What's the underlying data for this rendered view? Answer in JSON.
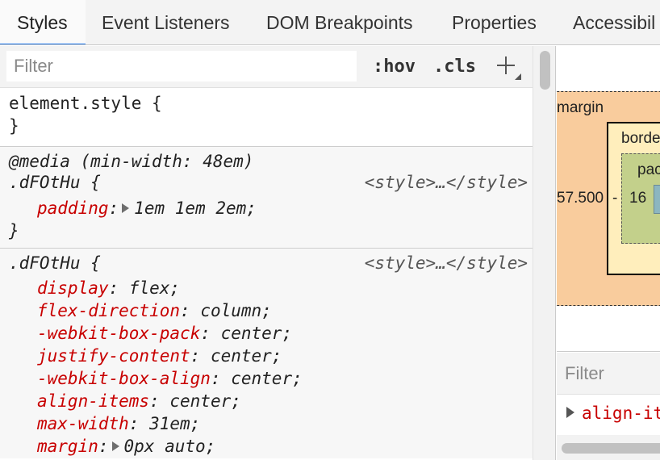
{
  "tabs": [
    {
      "label": "Styles",
      "active": true
    },
    {
      "label": "Event Listeners",
      "active": false
    },
    {
      "label": "DOM Breakpoints",
      "active": false
    },
    {
      "label": "Properties",
      "active": false
    },
    {
      "label": "Accessibil",
      "active": false
    }
  ],
  "toolbar": {
    "filter_placeholder": "Filter",
    "hov_label": ":hov",
    "cls_label": ".cls"
  },
  "rules": {
    "element_style": {
      "selector": "element.style {",
      "close": "}"
    },
    "media_rule": {
      "media": "@media (min-width: 48em)",
      "selector": ".dFOtHu {",
      "origin": "<style>…</style>",
      "props": [
        {
          "name": "padding",
          "value": "1em 1em 2em;",
          "expandable": true
        }
      ],
      "close": "}"
    },
    "main_rule": {
      "selector": ".dFOtHu {",
      "origin": "<style>…</style>",
      "props": [
        {
          "name": "display",
          "value": "flex;",
          "expandable": false
        },
        {
          "name": "flex-direction",
          "value": "column;",
          "expandable": false
        },
        {
          "name": "-webkit-box-pack",
          "value": "center;",
          "expandable": false
        },
        {
          "name": "justify-content",
          "value": "center;",
          "expandable": false
        },
        {
          "name": "-webkit-box-align",
          "value": "center;",
          "expandable": false
        },
        {
          "name": "align-items",
          "value": "center;",
          "expandable": false
        },
        {
          "name": "max-width",
          "value": "31em;",
          "expandable": false
        },
        {
          "name": "margin",
          "value": "0px auto;",
          "expandable": true
        }
      ]
    }
  },
  "box_model": {
    "margin_label": "margin",
    "border_label": "borde",
    "padding_label": "pac",
    "margin_left_value": "57.500",
    "border_left_value": "-",
    "padding_left_value": "16"
  },
  "computed": {
    "filter_placeholder": "Filter",
    "first_prop": "align-it"
  },
  "colors": {
    "active_tab_underline": "#1a73e8",
    "property_name": "#c80000",
    "margin_box": "#f9cc9d",
    "border_box": "#ffeebc",
    "padding_box": "#c3d08b",
    "content_box": "#8cb6c0"
  }
}
